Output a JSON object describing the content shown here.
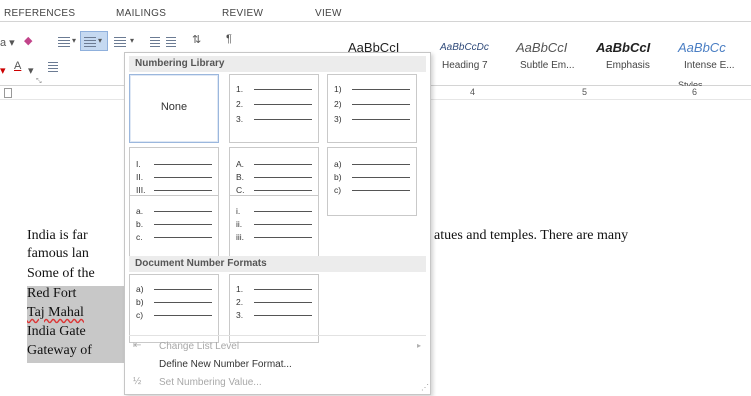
{
  "ribbon_tabs": [
    "REFERENCES",
    "MAILINGS",
    "REVIEW",
    "VIEW"
  ],
  "ribbon": {
    "styles_group_label": "Styles",
    "style_gallery": [
      {
        "preview": "AaBbCcI",
        "name": ""
      },
      {
        "preview": "AaBbCcDc",
        "name": "Heading 7"
      },
      {
        "preview": "AaBbCcI",
        "name": "Subtle Em..."
      },
      {
        "preview": "AaBbCcI",
        "name": "Emphasis"
      },
      {
        "preview": "AaBbCc",
        "name": "Intense E..."
      }
    ]
  },
  "ruler": {
    "numbers": [
      "4",
      "5",
      "6"
    ]
  },
  "document": {
    "line1_start": "India is far",
    "line1_end": "atues and temples. There are many",
    "line2": "famous lan",
    "line3": "Some of the",
    "list": [
      "Red Fort",
      "Taj Mahal",
      "India Gate",
      "Gateway of"
    ]
  },
  "numbering_menu": {
    "library_header": "Numbering Library",
    "document_formats_header": "Document Number Formats",
    "none_label": "None",
    "library_cells": [
      {
        "markers": [
          "1.",
          "2.",
          "3."
        ]
      },
      {
        "markers": [
          "1)",
          "2)",
          "3)"
        ]
      },
      {
        "markers": [
          "I.",
          "II.",
          "III."
        ]
      },
      {
        "markers": [
          "A.",
          "B.",
          "C."
        ]
      },
      {
        "markers": [
          "a)",
          "b)",
          "c)"
        ]
      },
      {
        "markers": [
          "a.",
          "b.",
          "c."
        ]
      },
      {
        "markers": [
          "i.",
          "ii.",
          "iii."
        ]
      }
    ],
    "document_cells": [
      {
        "markers": [
          "a)",
          "b)",
          "c)"
        ]
      },
      {
        "markers": [
          "1.",
          "2.",
          "3."
        ]
      }
    ],
    "commands": {
      "change_level": "Change List Level",
      "define_new": "Define New Number Format...",
      "set_value": "Set Numbering Value..."
    }
  }
}
